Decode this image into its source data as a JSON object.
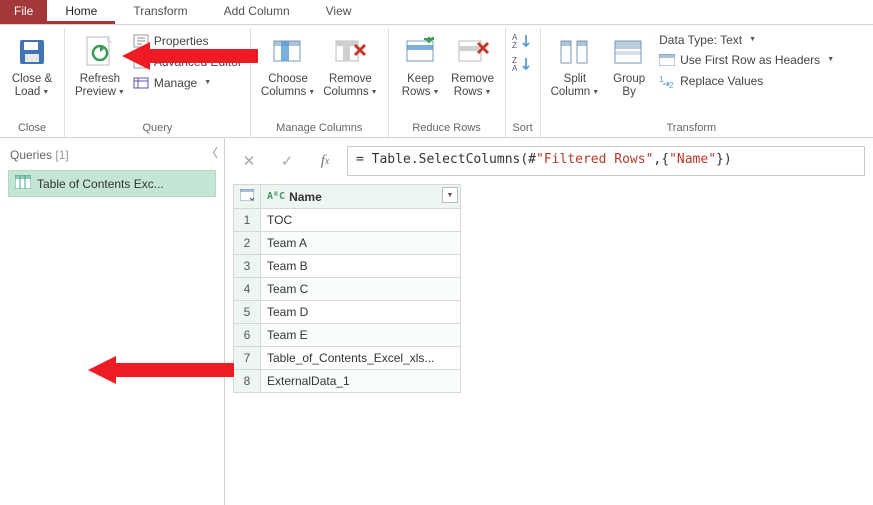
{
  "tabs": {
    "file": "File",
    "home": "Home",
    "transform": "Transform",
    "addcolumn": "Add Column",
    "view": "View"
  },
  "ribbon": {
    "close": {
      "btn1_l1": "Close &",
      "btn1_l2": "Load",
      "group": "Close"
    },
    "query": {
      "refresh_l1": "Refresh",
      "refresh_l2": "Preview",
      "properties": "Properties",
      "advanced": "Advanced Editor",
      "manage": "Manage",
      "group": "Query"
    },
    "manage_cols": {
      "choose_l1": "Choose",
      "choose_l2": "Columns",
      "remove_l1": "Remove",
      "remove_l2": "Columns",
      "group": "Manage Columns"
    },
    "reduce": {
      "keep_l1": "Keep",
      "keep_l2": "Rows",
      "remove_l1": "Remove",
      "remove_l2": "Rows",
      "group": "Reduce Rows"
    },
    "sort": {
      "group": "Sort"
    },
    "transform": {
      "split_l1": "Split",
      "split_l2": "Column",
      "group_l1": "Group",
      "group_l2": "By",
      "datatype": "Data Type: Text",
      "firstrow": "Use First Row as Headers",
      "replace": "Replace Values",
      "group": "Transform"
    }
  },
  "queries": {
    "title_a": "Queries",
    "title_b": "[1]",
    "item": "Table of Contents Exc..."
  },
  "formula": {
    "prefix": "= Table.SelectColumns(#",
    "arg1": "\"Filtered Rows\"",
    "mid": ",{",
    "arg2": "\"Name\"",
    "suffix": "})"
  },
  "grid": {
    "colname": "Name",
    "type_icon": "AᴮC",
    "rows": [
      "TOC",
      "Team A",
      "Team B",
      "Team C",
      "Team D",
      "Team E",
      "Table_of_Contents_Excel_xls...",
      "ExternalData_1"
    ]
  }
}
